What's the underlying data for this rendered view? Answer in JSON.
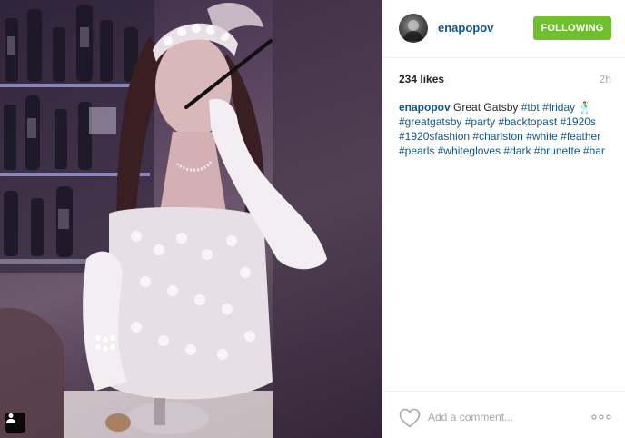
{
  "post": {
    "username": "enapopov",
    "follow_label": "FOLLOWING",
    "likes": "234 likes",
    "time_ago": "2h",
    "caption": {
      "user": "enapopov",
      "text": "Great Gatsby",
      "hashtags": [
        "#tbt",
        "#friday",
        "#greatgatsby",
        "#party",
        "#backtopast",
        "#1920s",
        "#1920sfashion",
        "#charlston",
        "#white",
        "#feather",
        "#pearls",
        "#whitegloves",
        "#dark",
        "#brunette",
        "#bar"
      ],
      "emoji": "🕺"
    },
    "comment_placeholder": "Add a comment..."
  },
  "icons": {
    "photo_user_tag": "person-icon",
    "like": "heart-outline-icon",
    "options": "more-options-icon"
  },
  "colors": {
    "link": "#125688",
    "follow_button": "#6fbf2e",
    "muted": "#a5a7aa"
  }
}
